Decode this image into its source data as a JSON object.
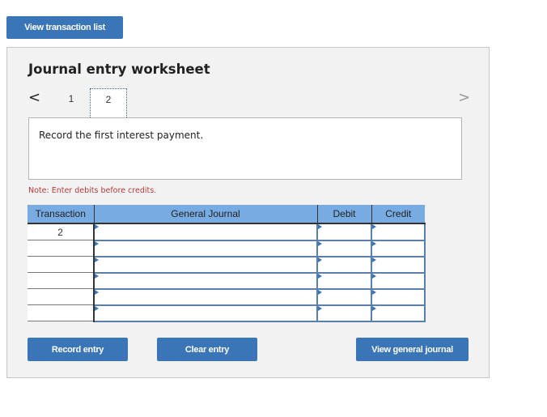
{
  "top": {
    "view_transaction_list_label": "View transaction list"
  },
  "worksheet": {
    "title": "Journal entry worksheet",
    "pagination": {
      "prev_icon": "chevron-left-icon",
      "next_icon": "chevron-right-icon",
      "prev_glyph": "<",
      "next_glyph": ">",
      "pages": [
        "1",
        "2"
      ],
      "current_page": "2"
    },
    "description": "Record the first interest payment.",
    "note": "Note: Enter debits before credits.",
    "table": {
      "headers": [
        "Transaction",
        "General Journal",
        "Debit",
        "Credit"
      ],
      "rows": [
        {
          "transaction": "2",
          "general_journal": "",
          "debit": "",
          "credit": ""
        },
        {
          "transaction": "",
          "general_journal": "",
          "debit": "",
          "credit": ""
        },
        {
          "transaction": "",
          "general_journal": "",
          "debit": "",
          "credit": ""
        },
        {
          "transaction": "",
          "general_journal": "",
          "debit": "",
          "credit": ""
        },
        {
          "transaction": "",
          "general_journal": "",
          "debit": "",
          "credit": ""
        },
        {
          "transaction": "",
          "general_journal": "",
          "debit": "",
          "credit": ""
        }
      ]
    },
    "buttons": {
      "record_entry": "Record entry",
      "clear_entry": "Clear entry",
      "view_general_journal": "View general journal"
    }
  },
  "colors": {
    "button_blue": "#3a75b8",
    "header_blue": "#77abe2",
    "note_red": "#b23a3a",
    "panel_bg": "#f2f2f2"
  }
}
